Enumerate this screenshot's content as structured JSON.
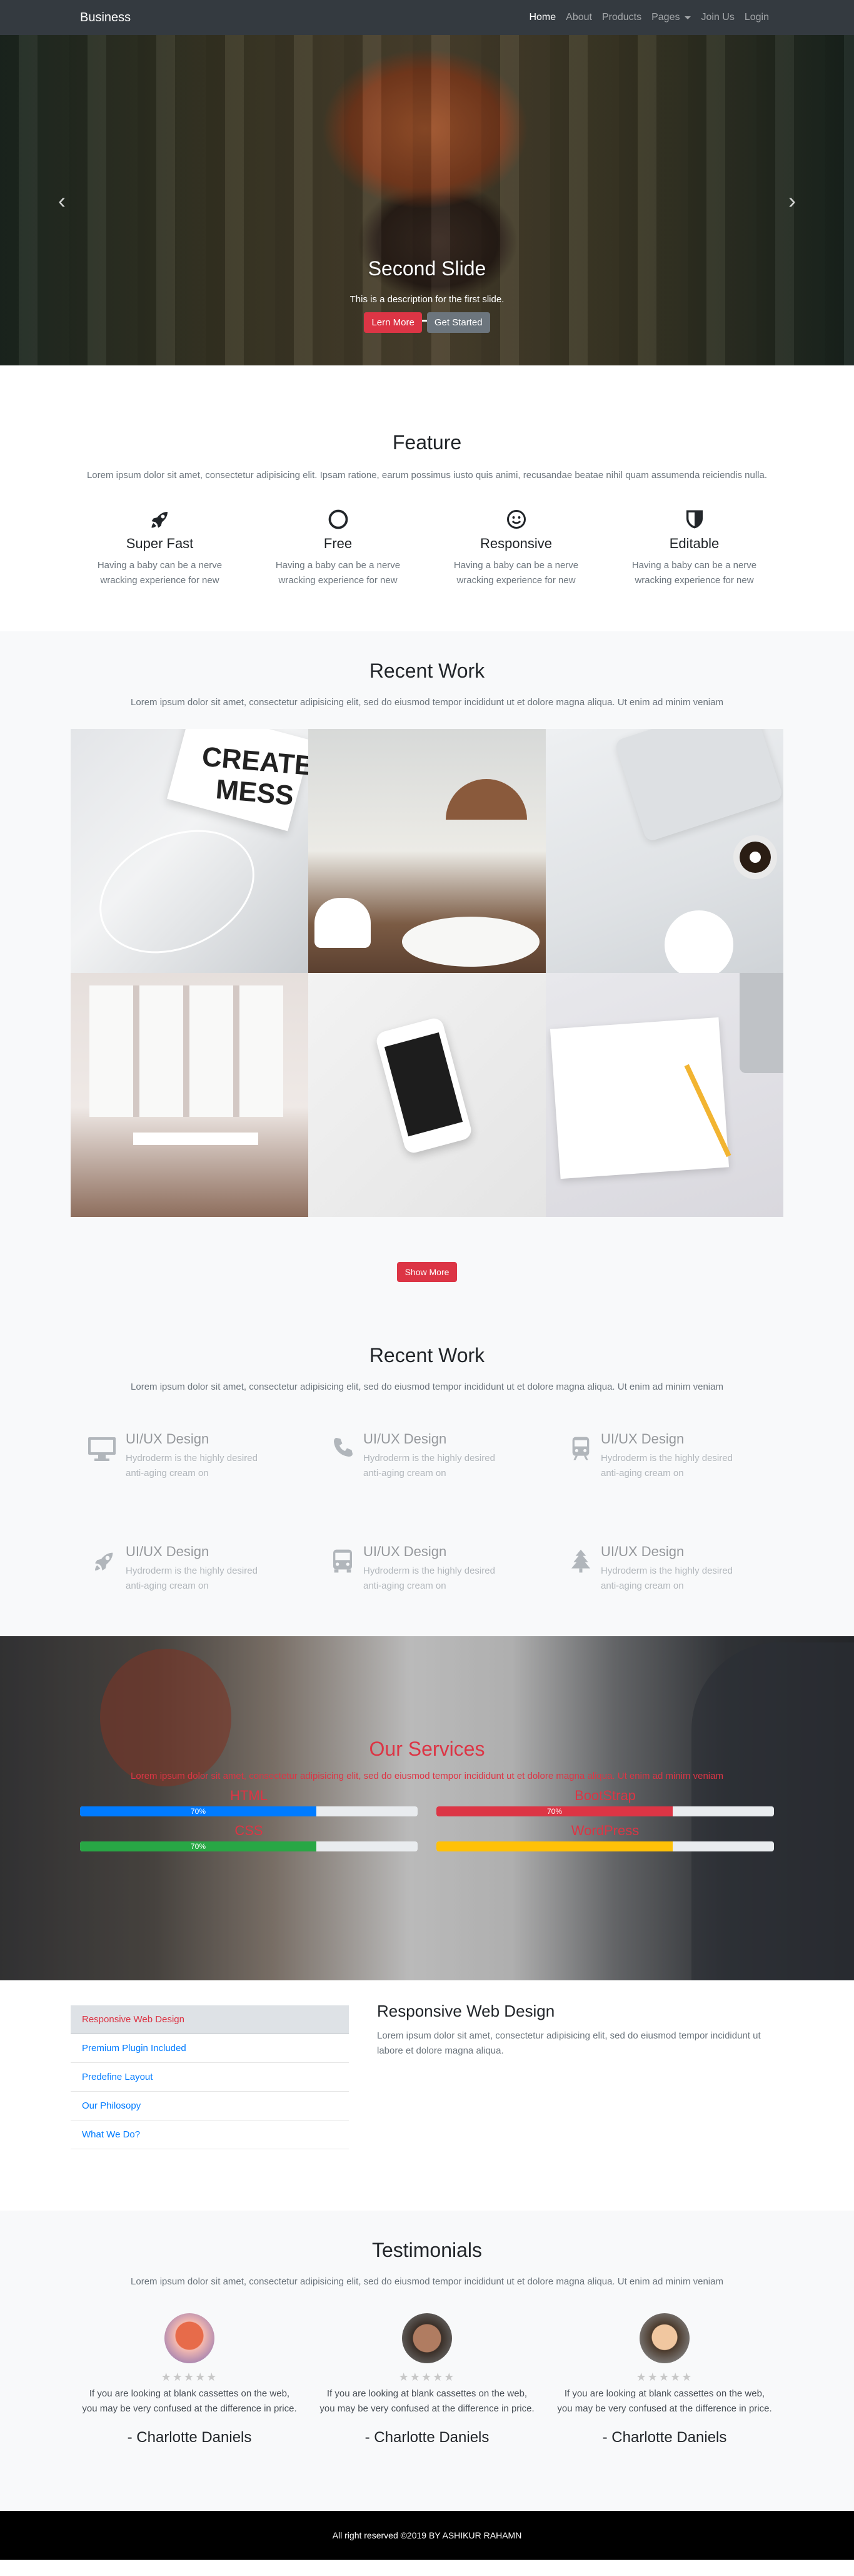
{
  "nav": {
    "brand": "Business",
    "links": [
      "Home",
      "About",
      "Products",
      "Pages",
      "Join Us",
      "Login"
    ]
  },
  "hero": {
    "title": "Second Slide",
    "description": "This is a description for the first slide.",
    "btn_primary": "Lern More",
    "btn_secondary": "Get Started",
    "prev_icon": "‹",
    "next_icon": "›"
  },
  "feature": {
    "title": "Feature",
    "text": "Lorem ipsum dolor sit amet, consectetur adipisicing elit. Ipsam ratione, earum possimus iusto quis animi, recusandae beatae nihil quam assumenda reiciendis nulla.",
    "items": [
      {
        "title": "Super Fast",
        "text": "Having a baby can be a nerve wracking experience for new",
        "icon": "rocket-icon"
      },
      {
        "title": "Free",
        "text": "Having a baby can be a nerve wracking experience for new",
        "icon": "circle-icon"
      },
      {
        "title": "Responsive",
        "text": "Having a baby can be a nerve wracking experience for new",
        "icon": "smile-icon"
      },
      {
        "title": "Editable",
        "text": "Having a baby can be a nerve wracking experience for new",
        "icon": "shield-icon"
      }
    ]
  },
  "recent_work": {
    "title": "Recent Work",
    "text": "Lorem ipsum dolor sit amet, consectetur adipisicing elit, sed do eiusmod tempor incididunt ut et dolore magna aliqua. Ut enim ad minim veniam",
    "book_text": "CREATE MESS",
    "show_more": "Show More"
  },
  "recent_work2": {
    "title": "Recent Work",
    "text": "Lorem ipsum dolor sit amet, consectetur adipisicing elit, sed do eiusmod tempor incididunt ut et dolore magna aliqua. Ut enim ad minim veniam",
    "items": [
      {
        "title": "UI/UX Design",
        "text": "Hydroderm is the highly desired anti-aging cream on",
        "icon": "desktop-icon"
      },
      {
        "title": "UI/UX Design",
        "text": "Hydroderm is the highly desired anti-aging cream on",
        "icon": "phone-icon"
      },
      {
        "title": "UI/UX Design",
        "text": "Hydroderm is the highly desired anti-aging cream on",
        "icon": "train-icon"
      },
      {
        "title": "UI/UX Design",
        "text": "Hydroderm is the highly desired anti-aging cream on",
        "icon": "rocket-icon"
      },
      {
        "title": "UI/UX Design",
        "text": "Hydroderm is the highly desired anti-aging cream on",
        "icon": "bus-icon"
      },
      {
        "title": "UI/UX Design",
        "text": "Hydroderm is the highly desired anti-aging cream on",
        "icon": "tree-icon"
      }
    ]
  },
  "services": {
    "title": "Our Services",
    "text": "Lorem ipsum dolor sit amet, consectetur adipisicing elit, sed do eiusmod tempor incididunt ut et dolore magna aliqua. Ut enim ad minim veniam",
    "bars": [
      {
        "name": "HTML",
        "percent": 70,
        "label": "70%",
        "color": "#007bff"
      },
      {
        "name": "BootStrap",
        "percent": 70,
        "label": "70%",
        "color": "#dc3545"
      },
      {
        "name": "CSS",
        "percent": 70,
        "label": "70%",
        "color": "#28a745"
      },
      {
        "name": "WordPress",
        "percent": 70,
        "label": "",
        "color": "#ffc107"
      }
    ]
  },
  "tabs": {
    "items": [
      "Responsive Web Design",
      "Premium Plugin Included",
      "Predefine Layout",
      "Our Philosopy",
      "What We Do?"
    ],
    "active_title": "Responsive Web Design",
    "active_text": "Lorem ipsum dolor sit amet, consectetur adipisicing elit, sed do eiusmod tempor incididunt ut labore et dolore magna aliqua."
  },
  "testimonials": {
    "title": "Testimonials",
    "text": "Lorem ipsum dolor sit amet, consectetur adipisicing elit, sed do eiusmod tempor incididunt ut et dolore magna aliqua. Ut enim ad minim veniam",
    "stars": "★★★★★",
    "items": [
      {
        "quote": "If you are looking at blank cassettes on the web, you may be very confused at the difference in price.",
        "name": "- Charlotte Daniels"
      },
      {
        "quote": "If you are looking at blank cassettes on the web, you may be very confused at the difference in price.",
        "name": "- Charlotte Daniels"
      },
      {
        "quote": "If you are looking at blank cassettes on the web, you may be very confused at the difference in price.",
        "name": "- Charlotte Daniels"
      }
    ]
  },
  "footer": {
    "text": "All right reserved ©2019 BY ASHIKUR RAHAMN"
  },
  "colors": {
    "nav_bg": "#343a40",
    "accent_red": "#dc3545",
    "link_blue": "#007bff",
    "section_bg": "#f8f9fa",
    "footer_bg": "#000000"
  }
}
